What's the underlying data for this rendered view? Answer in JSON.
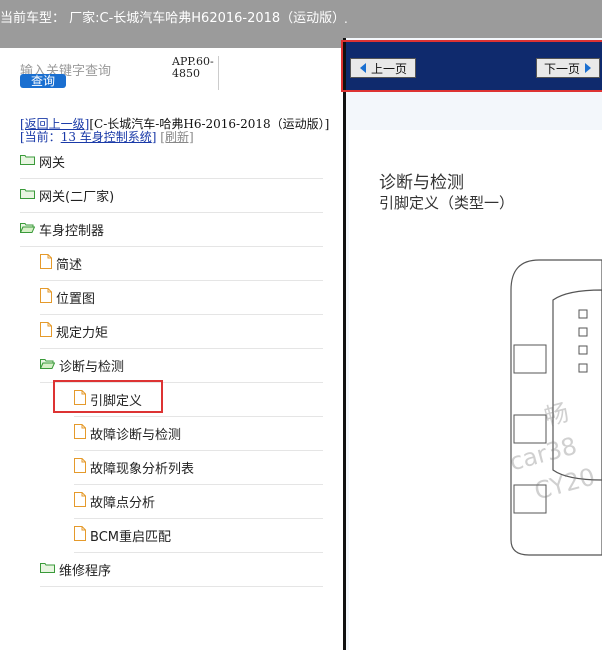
{
  "header": {
    "title": "当前车型： 厂家:C-长城汽车哈弗H62016-2018（运动版）",
    "mark": "."
  },
  "search": {
    "placeholder": "输入关键字查询",
    "button": "查询",
    "app_code": "APP.60-4850"
  },
  "breadcrumb": {
    "back": "[返回上一级]",
    "path": "[C-长城汽车-哈弗H6-2016-2018（运动版）]",
    "current_prefix": "[当前：",
    "current": "13 车身控制系统",
    "current_suffix": "]",
    "refresh": "[刷新]"
  },
  "tree": [
    {
      "label": "网关",
      "type": "folder"
    },
    {
      "label": "网关(二厂家)",
      "type": "folder"
    },
    {
      "label": "车身控制器",
      "type": "folder-open"
    },
    {
      "label": "简述",
      "type": "doc"
    },
    {
      "label": "位置图",
      "type": "doc"
    },
    {
      "label": "规定力矩",
      "type": "doc"
    },
    {
      "label": "诊断与检测",
      "type": "folder-open"
    },
    {
      "label": "引脚定义",
      "type": "doc"
    },
    {
      "label": "故障诊断与检测",
      "type": "doc"
    },
    {
      "label": "故障现象分析列表",
      "type": "doc"
    },
    {
      "label": "故障点分析",
      "type": "doc"
    },
    {
      "label": "BCM重启匹配",
      "type": "doc"
    },
    {
      "label": "维修程序",
      "type": "folder"
    }
  ],
  "nav": {
    "prev": "上一页",
    "next": "下一页"
  },
  "document": {
    "title": "诊断与检测",
    "subtitle": "引脚定义（类型一）",
    "watermark1": "畅",
    "watermark2": "car38",
    "watermark3": "CY20"
  },
  "colors": {
    "accent": "#d33333",
    "navbar": "#0f2a6d",
    "header": "#9b9b9b"
  }
}
